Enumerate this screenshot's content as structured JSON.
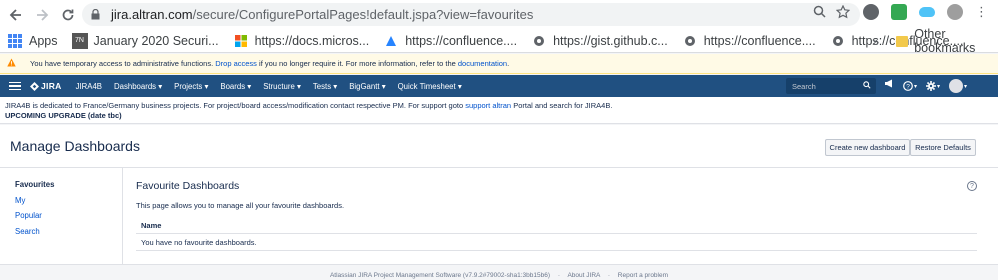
{
  "browser": {
    "url_prefix": "jira.altran.com",
    "url_path": "/secure/ConfigurePortalPages!default.jspa?view=favourites"
  },
  "bookmarks": {
    "items": [
      {
        "label": "Apps"
      },
      {
        "label": "January 2020 Securi..."
      },
      {
        "label": "https://docs.micros..."
      },
      {
        "label": "https://confluence...."
      },
      {
        "label": "https://gist.github.c..."
      },
      {
        "label": "https://confluence...."
      },
      {
        "label": "https://confluence...."
      }
    ],
    "overflow": "»",
    "other": "Other bookmarks"
  },
  "admin_warning": {
    "prefix": "You have temporary access to administrative functions.",
    "drop_link": "Drop access",
    "middle": "if you no longer require it. For more information, refer to the",
    "doc_link": "documentation",
    "suffix": "."
  },
  "jira_nav": {
    "logo": "JIRA",
    "items": [
      "JIRA4B",
      "Dashboards ▾",
      "Projects ▾",
      "Boards ▾",
      "Structure ▾",
      "Tests ▾",
      "BigGantt ▾",
      "Quick Timesheet ▾"
    ],
    "search_placeholder": "Search"
  },
  "info_banner": {
    "line1_prefix": "JIRA4B is dedicated to France/Germany business projects. For project/board access/modification contact respective PM. For support goto",
    "support_link": "support altran",
    "line1_suffix": "Portal and search for JIRA4B.",
    "upgrade": "UPCOMING UPGRADE (date tbc)"
  },
  "page": {
    "title": "Manage Dashboards",
    "create_button": "Create new dashboard",
    "restore_button": "Restore Defaults"
  },
  "sidebar": {
    "items": [
      "Favourites",
      "My",
      "Popular",
      "Search"
    ]
  },
  "main": {
    "section_title": "Favourite Dashboards",
    "description": "This page allows you to manage all your favourite dashboards.",
    "column_name": "Name",
    "empty_message": "You have no favourite dashboards."
  },
  "footer": {
    "software": "Atlassian JIRA Project Management Software (v7.9.2#79002-sha1:3bb15b6)",
    "about": "About JIRA",
    "report": "Report a problem"
  },
  "colors": {
    "jira_nav": "#205081",
    "link": "#0052cc",
    "warning_bg": "#fffae6"
  }
}
